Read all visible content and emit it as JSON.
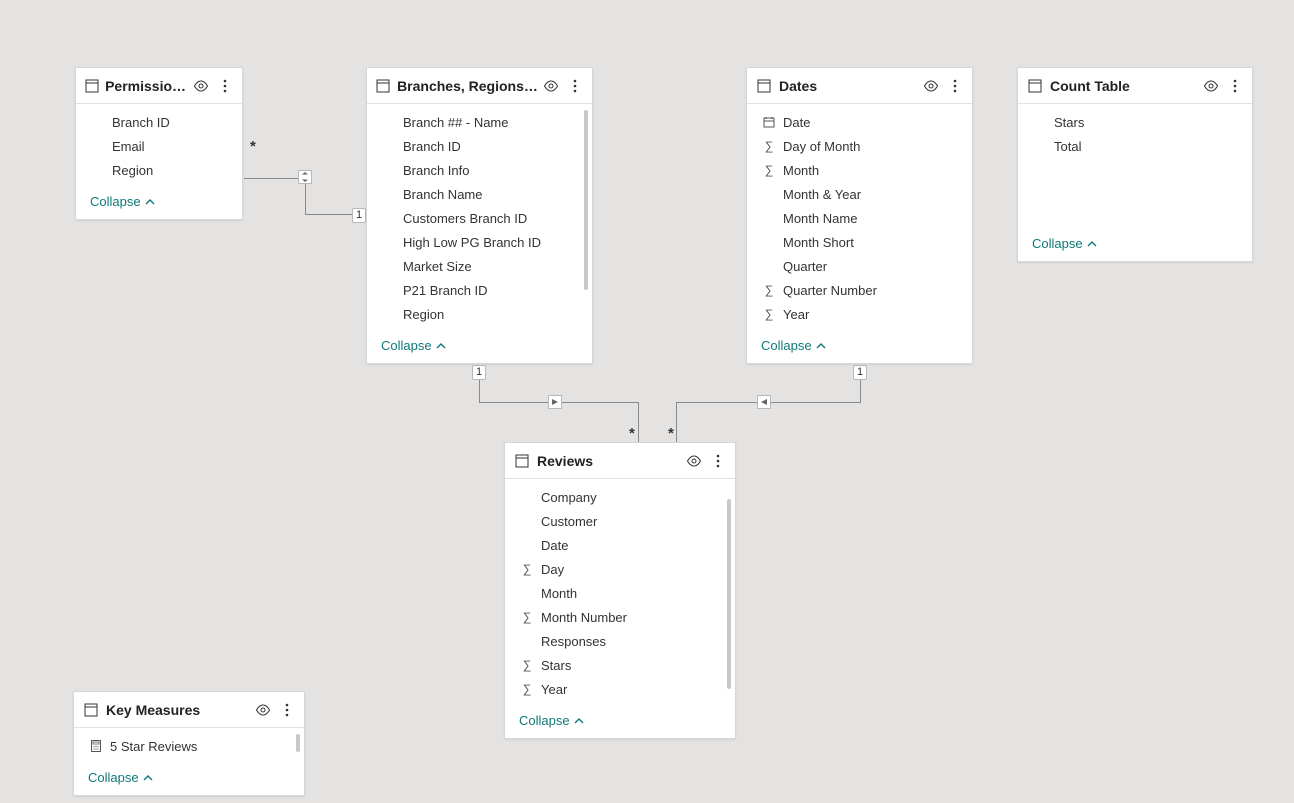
{
  "tables": {
    "permissions": {
      "title": "Permissions ...",
      "collapse": "Collapse",
      "fields": [
        {
          "name": "Branch ID",
          "icon": ""
        },
        {
          "name": "Email",
          "icon": ""
        },
        {
          "name": "Region",
          "icon": ""
        }
      ]
    },
    "branches": {
      "title": "Branches, Regions, M...",
      "collapse": "Collapse",
      "fields": [
        {
          "name": "Branch ## - Name",
          "icon": ""
        },
        {
          "name": "Branch ID",
          "icon": ""
        },
        {
          "name": "Branch Info",
          "icon": ""
        },
        {
          "name": "Branch Name",
          "icon": ""
        },
        {
          "name": "Customers Branch ID",
          "icon": ""
        },
        {
          "name": "High Low PG Branch ID",
          "icon": ""
        },
        {
          "name": "Market Size",
          "icon": ""
        },
        {
          "name": "P21 Branch ID",
          "icon": ""
        },
        {
          "name": "Region",
          "icon": ""
        }
      ]
    },
    "dates": {
      "title": "Dates",
      "collapse": "Collapse",
      "fields": [
        {
          "name": "Date",
          "icon": "calendar"
        },
        {
          "name": "Day of Month",
          "icon": "sigma"
        },
        {
          "name": "Month",
          "icon": "sigma"
        },
        {
          "name": "Month & Year",
          "icon": ""
        },
        {
          "name": "Month Name",
          "icon": ""
        },
        {
          "name": "Month Short",
          "icon": ""
        },
        {
          "name": "Quarter",
          "icon": ""
        },
        {
          "name": "Quarter Number",
          "icon": "sigma"
        },
        {
          "name": "Year",
          "icon": "sigma"
        }
      ]
    },
    "count": {
      "title": "Count Table",
      "collapse": "Collapse",
      "fields": [
        {
          "name": "Stars",
          "icon": ""
        },
        {
          "name": "Total",
          "icon": ""
        }
      ]
    },
    "reviews": {
      "title": "Reviews",
      "collapse": "Collapse",
      "fields": [
        {
          "name": "Company",
          "icon": ""
        },
        {
          "name": "Customer",
          "icon": ""
        },
        {
          "name": "Date",
          "icon": ""
        },
        {
          "name": "Day",
          "icon": "sigma"
        },
        {
          "name": "Month",
          "icon": ""
        },
        {
          "name": "Month Number",
          "icon": "sigma"
        },
        {
          "name": "Responses",
          "icon": ""
        },
        {
          "name": "Stars",
          "icon": "sigma"
        },
        {
          "name": "Year",
          "icon": "sigma"
        }
      ]
    },
    "keymeasures": {
      "title": "Key Measures",
      "collapse": "Collapse",
      "fields": [
        {
          "name": "5 Star Reviews",
          "icon": "calculator"
        }
      ]
    }
  },
  "relations": {
    "perm_branches": {
      "from_card": "*",
      "to_card": "1",
      "direction": "both"
    },
    "branches_reviews": {
      "from_card": "1",
      "to_card": "*",
      "direction": "single-right"
    },
    "dates_reviews": {
      "from_card": "1",
      "to_card": "*",
      "direction": "single-left"
    }
  }
}
